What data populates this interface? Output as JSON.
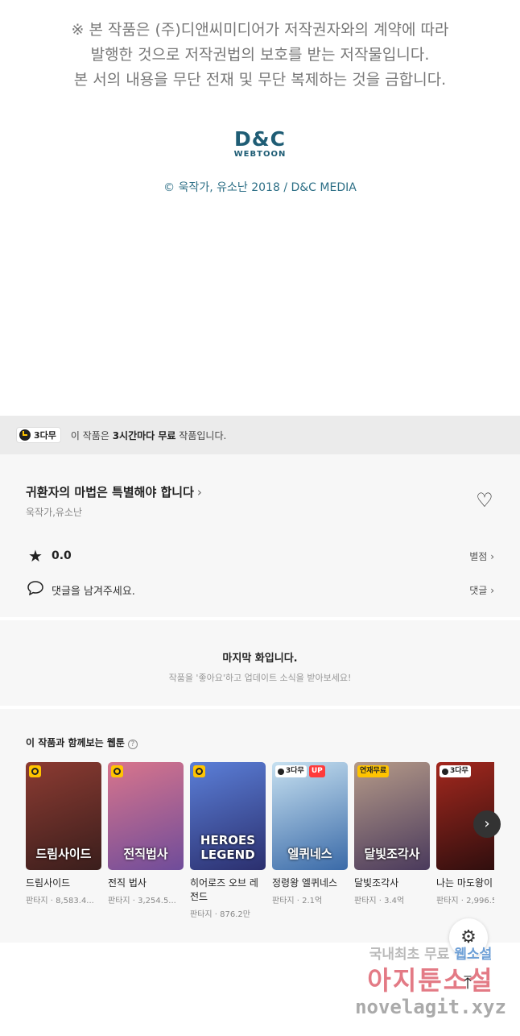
{
  "notice": {
    "line1": "※ 본 작품은 (주)디앤씨미디어가 저작권자와의 계약에 따라",
    "line2": "발행한 것으로 저작권법의 보호를 받는 저작물입니다.",
    "line3": "본 서의 내용을 무단 전재 및 무단 복제하는 것을 금합니다."
  },
  "logo": {
    "top": "D&C",
    "bottom": "WEBTOON"
  },
  "copyright": "© 욱작가, 유소난 2018 / D&C MEDIA",
  "free_bar": {
    "badge": "3다무",
    "text_pre": "이 작품은 ",
    "text_bold": "3시간마다 무료",
    "text_post": " 작품입니다."
  },
  "work": {
    "title": "귀환자의 마법은 특별해야 합니다",
    "authors": "욱작가,유소난",
    "rating": "0.0",
    "rating_link": "별점",
    "comment_placeholder": "댓글을 남겨주세요.",
    "comment_link": "댓글"
  },
  "last_episode": {
    "heading": "마지막 화입니다.",
    "sub": "작품을 '좋아요'하고 업데이트 소식을 받아보세요!"
  },
  "recommend": {
    "title": "이 작품과 함께보는 웹툰",
    "items": [
      {
        "name": "드림사이드",
        "meta": "판타지 · 8,583.4...",
        "cover_text": "드림사이드",
        "tags": [
          "clock"
        ],
        "color1": "#3a1e1c",
        "color2": "#8c3b32"
      },
      {
        "name": "전직 법사",
        "meta": "판타지 · 3,254.5...",
        "cover_text": "전직법사",
        "tags": [
          "clock"
        ],
        "color1": "#6f4c9a",
        "color2": "#d8758c"
      },
      {
        "name": "히어로즈 오브 레전드",
        "meta": "판타지 · 876.2만",
        "cover_text": "HEROES LEGEND",
        "tags": [
          "clock"
        ],
        "color1": "#2b2f6e",
        "color2": "#5b7fd8"
      },
      {
        "name": "정령왕 엘퀴네스",
        "meta": "판타지 · 2.1억",
        "cover_text": "엘퀴네스",
        "tags": [
          "d3",
          "up"
        ],
        "color1": "#3a6aa8",
        "color2": "#c6e0f0"
      },
      {
        "name": "달빛조각사",
        "meta": "판타지 · 3.4억",
        "cover_text": "달빛조각사",
        "tags": [
          "free"
        ],
        "color1": "#4a3a5c",
        "color2": "#b59a88"
      },
      {
        "name": "나는 마도왕이",
        "meta": "판타지 · 2,996.5",
        "cover_text": "",
        "tags": [
          "d3"
        ],
        "color1": "#2a0d0d",
        "color2": "#a3281e"
      }
    ],
    "tag_labels": {
      "d3": "3다무",
      "up": "UP",
      "free": "연재무료"
    }
  },
  "watermark": {
    "line1_pre": "국내최초 무료 ",
    "line1_hl": "웹소설",
    "line2": "아지툰소설",
    "line3": "novelagit.xyz"
  }
}
